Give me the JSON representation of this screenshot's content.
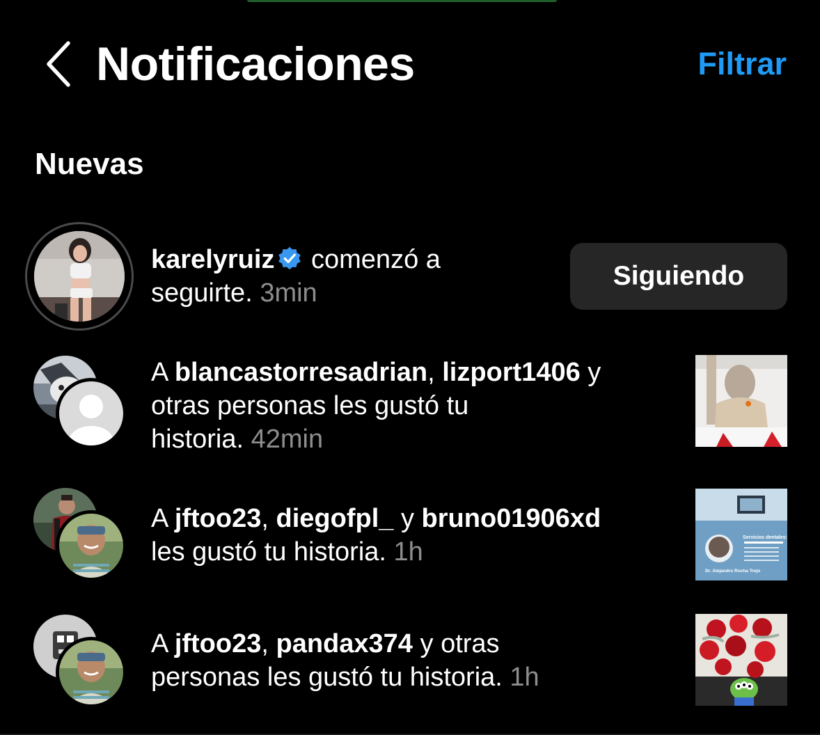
{
  "header": {
    "title": "Notificaciones",
    "filter_label": "Filtrar",
    "accent_color": "#1f9bf5"
  },
  "section": {
    "title": "Nuevas"
  },
  "notifications": [
    {
      "user": "karelyruiz",
      "verified": true,
      "action_line1": " comenzó a",
      "action_line2": "seguirte. ",
      "time": "3min",
      "button_label": "Siguiendo"
    },
    {
      "prefix": "A ",
      "user1": "blancastorresadrian",
      "sep1": ", ",
      "user2": "lizport1406",
      "mid": " y",
      "line2": "otras personas les gustó tu",
      "line3": "historia. ",
      "time": "42min"
    },
    {
      "prefix": "A ",
      "user1": "jftoo23",
      "sep1": ", ",
      "user2": "diegofpl_",
      "mid": " y ",
      "user3": "bruno01906xd",
      "line2": "les gustó tu historia. ",
      "time": "1h"
    },
    {
      "prefix": "A ",
      "user1": "jftoo23",
      "sep1": ", ",
      "user2": "pandax374",
      "mid": " y otras",
      "line2": "personas les gustó tu historia. ",
      "time": "1h"
    }
  ],
  "icons": {
    "back": "chevron-left-icon",
    "verified": "verified-badge-icon",
    "default_avatar": "person-silhouette-icon"
  },
  "thumbnails": {
    "story2_caption": "Servicios dentales:",
    "story2_name": "Dr. Alejandro Rocha Trejo"
  }
}
